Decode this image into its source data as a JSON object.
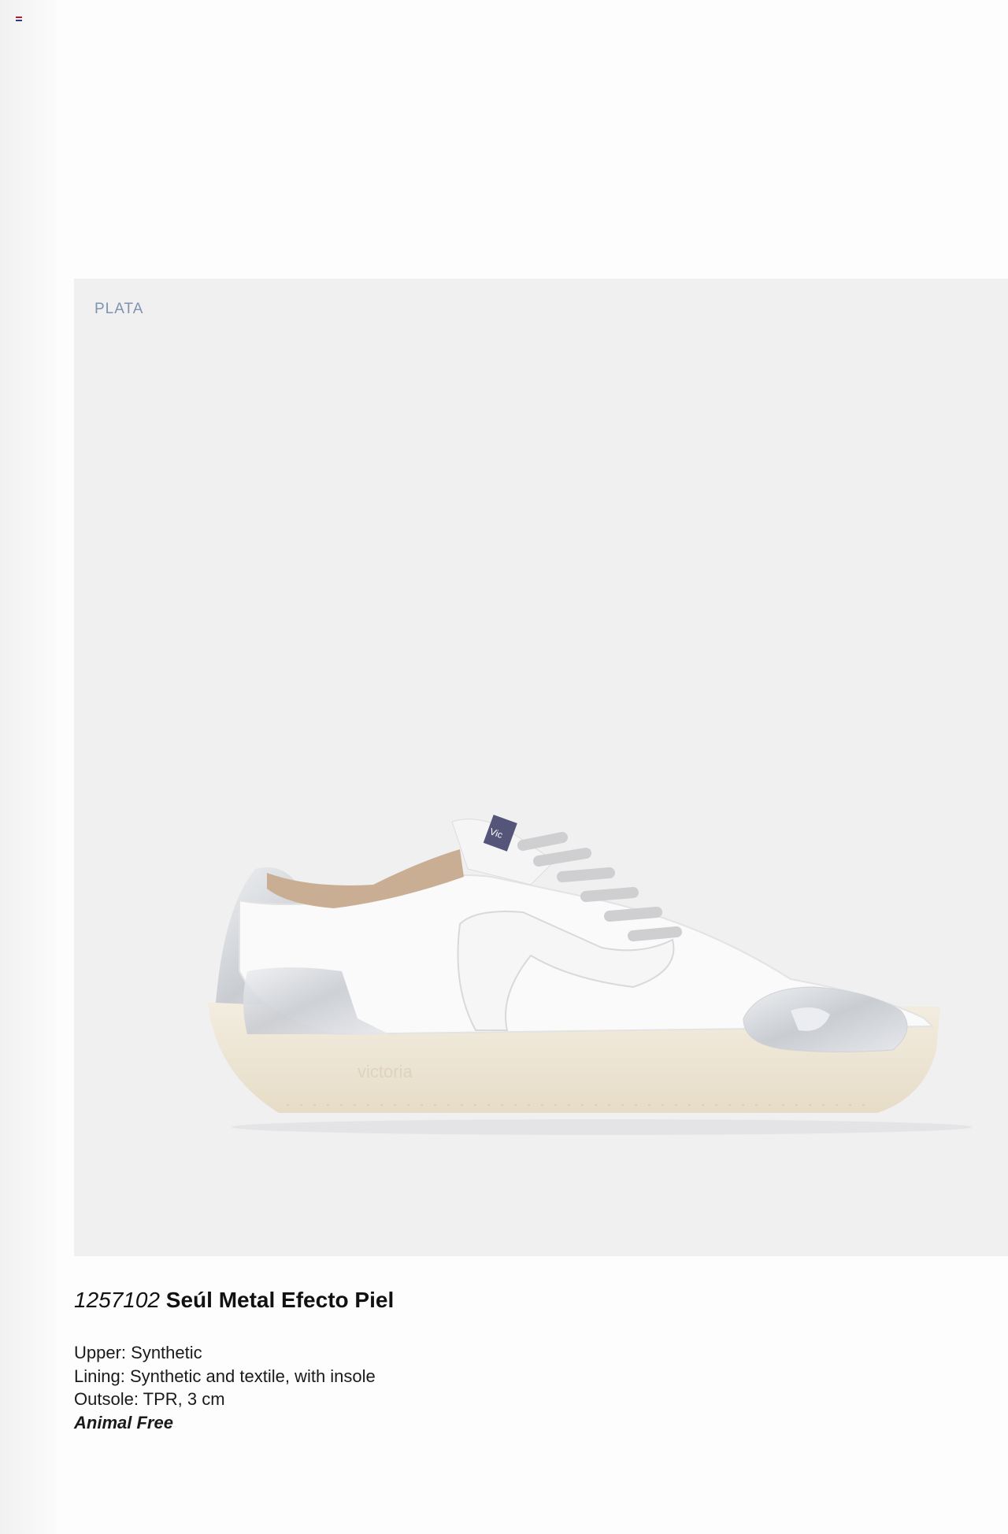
{
  "page": {
    "color_label": "PLATA",
    "product_code": "1257102",
    "product_name": "Seúl Metal Efecto Piel",
    "specs": {
      "upper": "Upper: Synthetic",
      "lining": "Lining: Synthetic and textile, with insole",
      "outsole": "Outsole: TPR, 3 cm",
      "animal": "Animal Free"
    },
    "shoe_sole_text": "victoria",
    "heel_tab_text": "Vic"
  },
  "colors": {
    "background": "#fdfdfd",
    "photo_background": "#f0f0f1",
    "color_label": "#7f93b0",
    "silver": "#d3d6da",
    "sole": "#efe8d8"
  },
  "icons": {
    "flag": "flag-icon"
  }
}
